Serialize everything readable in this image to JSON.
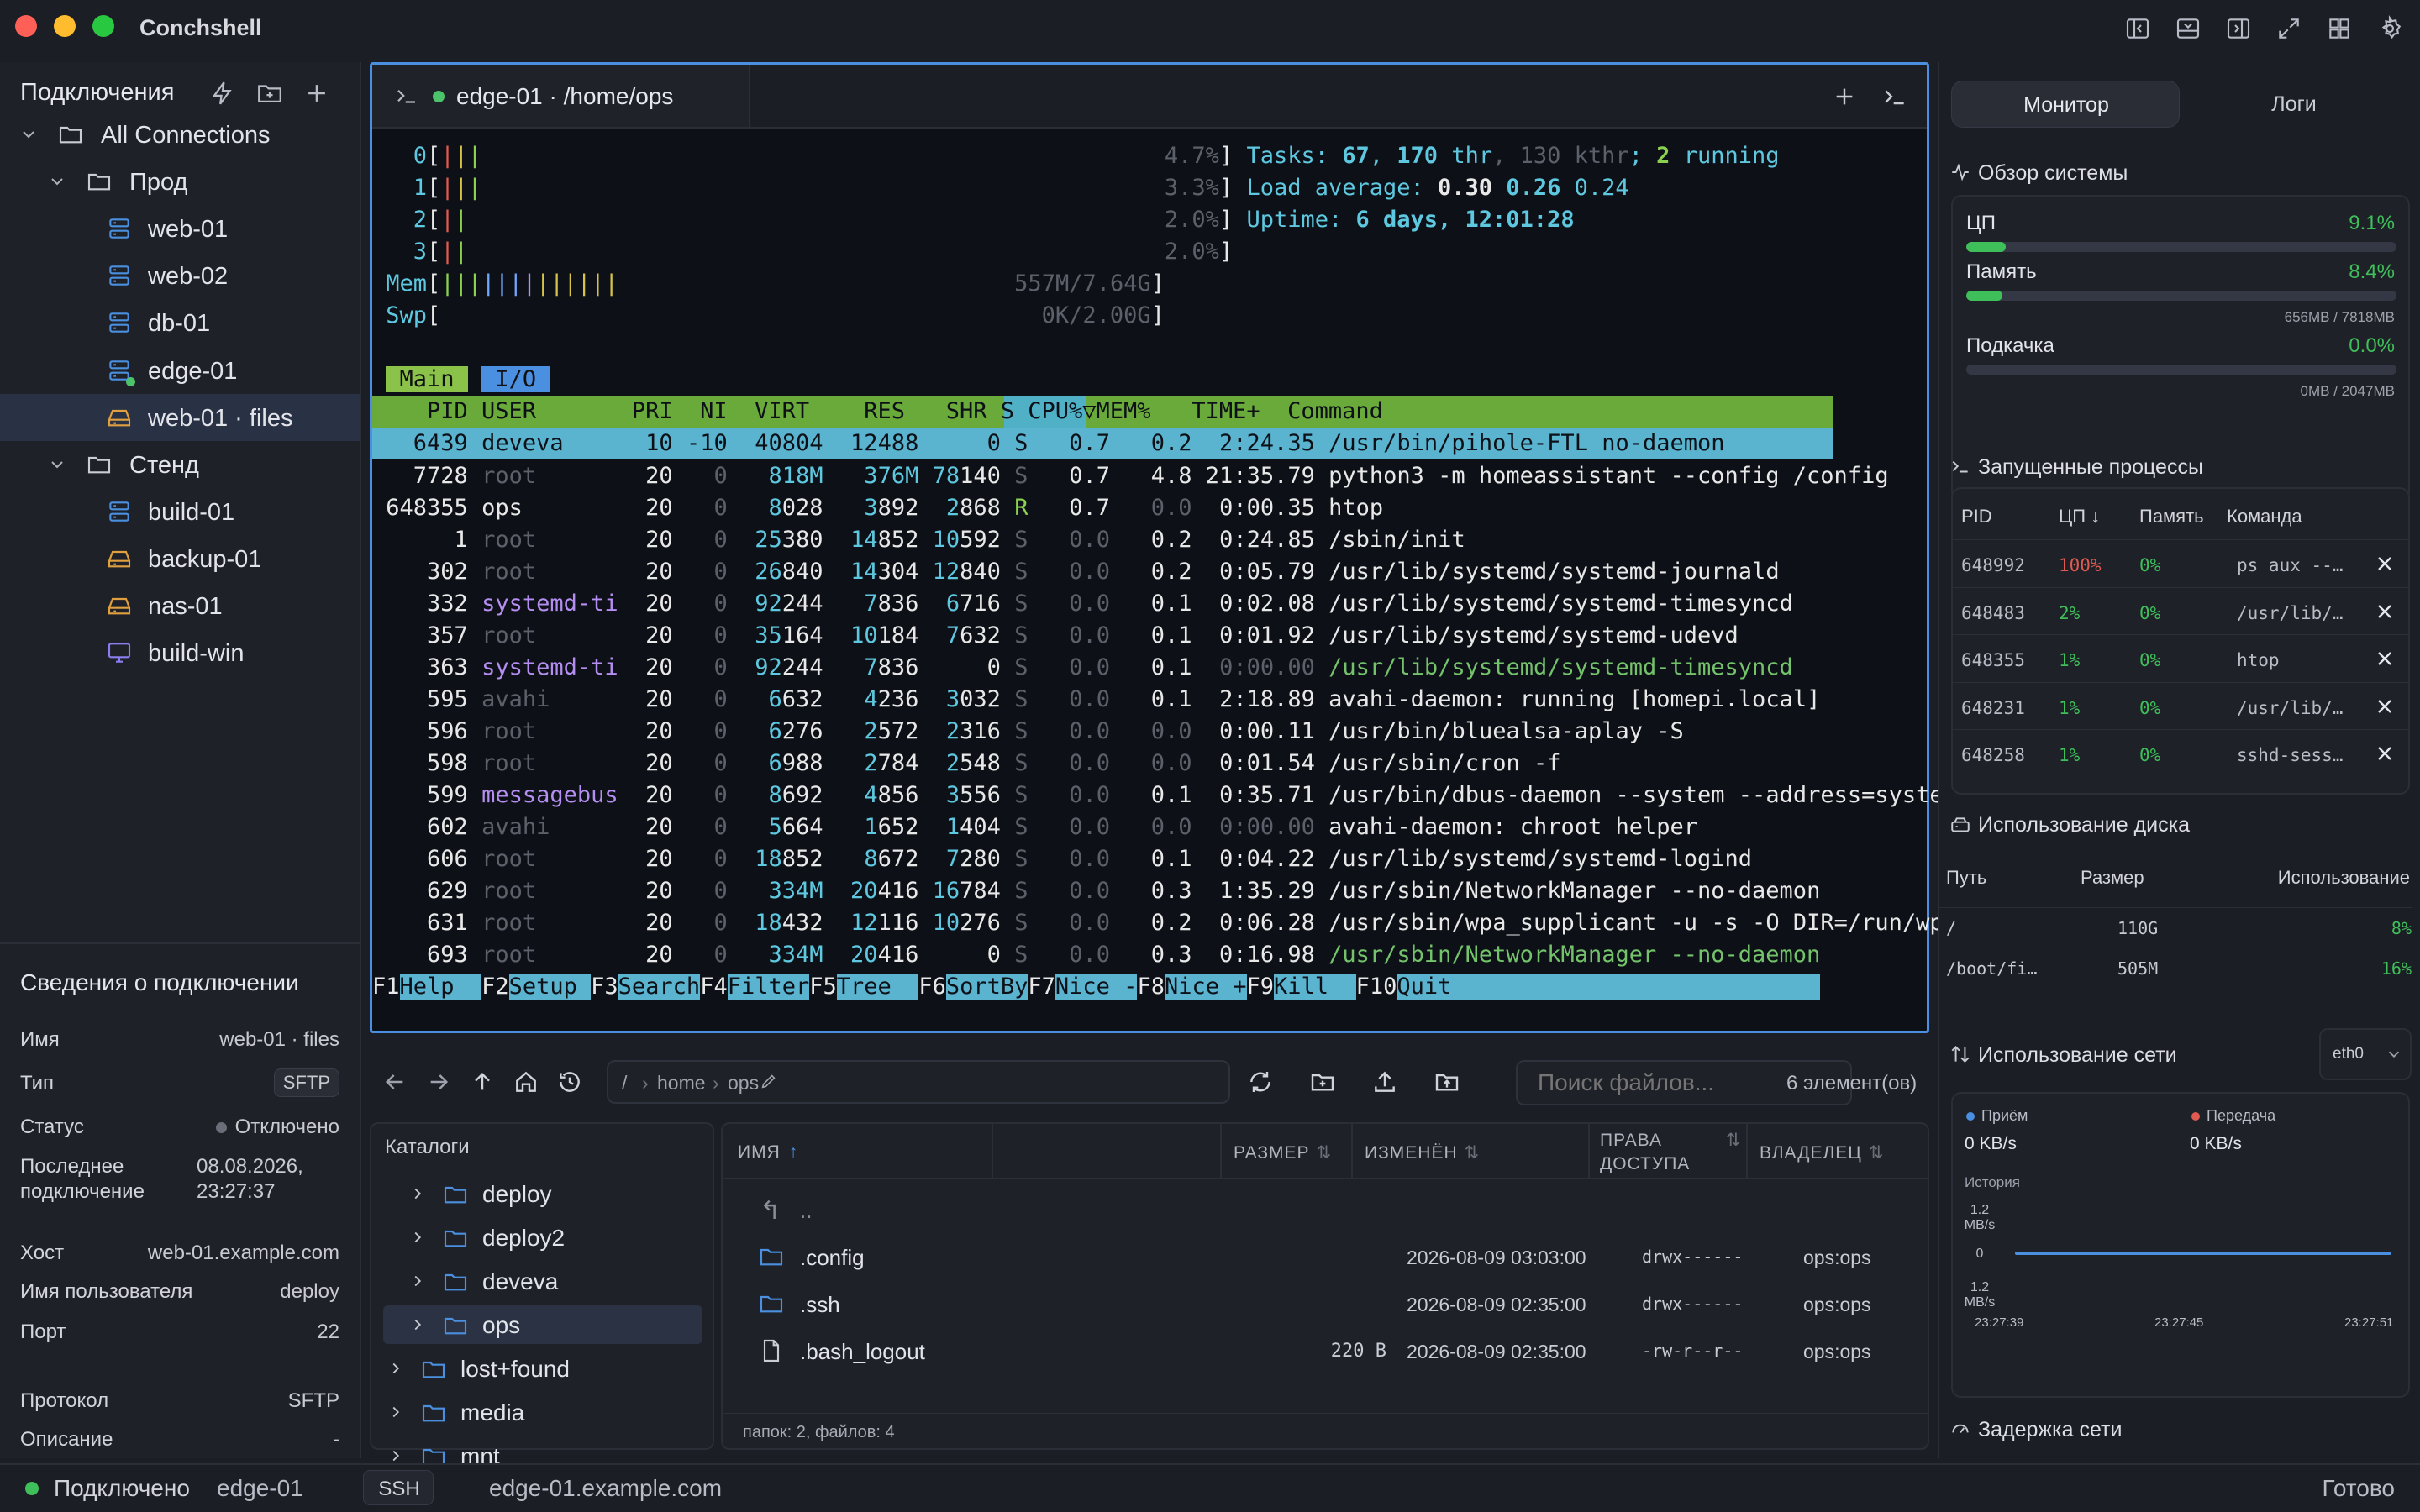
{
  "app": {
    "title": "Conchshell"
  },
  "sidebar": {
    "header": "Подключения",
    "tree": [
      {
        "label": "All Connections",
        "level": 0,
        "kind": "folder",
        "expanded": true
      },
      {
        "label": "Прод",
        "level": 1,
        "kind": "folder",
        "expanded": true
      },
      {
        "label": "web-01",
        "level": 2,
        "kind": "server"
      },
      {
        "label": "web-02",
        "level": 2,
        "kind": "server"
      },
      {
        "label": "db-01",
        "level": 2,
        "kind": "server"
      },
      {
        "label": "edge-01",
        "level": 2,
        "kind": "server",
        "connected": true
      },
      {
        "label": "web-01 · files",
        "level": 2,
        "kind": "files",
        "selected": true
      },
      {
        "label": "Стенд",
        "level": 1,
        "kind": "folder",
        "expanded": true
      },
      {
        "label": "build-01",
        "level": 2,
        "kind": "server"
      },
      {
        "label": "backup-01",
        "level": 2,
        "kind": "files"
      },
      {
        "label": "nas-01",
        "level": 2,
        "kind": "files"
      },
      {
        "label": "build-win",
        "level": 2,
        "kind": "desktop"
      }
    ],
    "info": {
      "title": "Сведения о подключении",
      "rows": [
        {
          "k": "Имя",
          "v": "web-01 · files"
        },
        {
          "k": "Тип",
          "v": "SFTP"
        },
        {
          "k": "Статус",
          "v": "Отключено"
        },
        {
          "k": "Последнее подключение",
          "v": "08.08.2026, 23:27:37"
        },
        {
          "k": "Хост",
          "v": "web-01.example.com"
        },
        {
          "k": "Имя пользователя",
          "v": "deploy"
        },
        {
          "k": "Порт",
          "v": "22"
        },
        {
          "k": "Протокол",
          "v": "SFTP"
        },
        {
          "k": "Описание",
          "v": "-"
        }
      ]
    }
  },
  "terminal": {
    "tab_title": "edge-01 · /home/ops",
    "cpus": [
      {
        "id": "0",
        "pct": "4.7%"
      },
      {
        "id": "1",
        "pct": "3.3%"
      },
      {
        "id": "2",
        "pct": "2.0%"
      },
      {
        "id": "3",
        "pct": "2.0%"
      }
    ],
    "mem": {
      "label": "Mem",
      "value": "557M/7.64G"
    },
    "swp": {
      "label": "Swp",
      "value": "0K/2.00G"
    },
    "tasks": {
      "label": "Tasks:",
      "tasks": "67",
      "thr": "170",
      "kthr": "130",
      "running": "2"
    },
    "load": {
      "label": "Load average:",
      "l1": "0.30",
      "l5": "0.26",
      "l15": "0.24"
    },
    "uptime": {
      "label": "Uptime:",
      "value": "6 days, 12:01:28"
    },
    "tabs": [
      "Main",
      "I/O"
    ],
    "columns": {
      "pid": "PID",
      "user": "USER",
      "pri": "PRI",
      "ni": "NI",
      "virt": "VIRT",
      "res": "RES",
      "shr": "SHR",
      "s": "S",
      "cpu": "CPU%▽",
      "mem": "MEM%",
      "time": "TIME+",
      "cmd": "Command"
    },
    "processes": [
      {
        "pid": "6439",
        "user": "deveva",
        "pri": "10",
        "ni": "-10",
        "virt": "40804",
        "res": "12488",
        "shr": "0",
        "s": "S",
        "cpu": "0.7",
        "mem": "0.2",
        "time": "2:24.35",
        "cmd": "/usr/bin/pihole-FTL no-daemon",
        "sel": true
      },
      {
        "pid": "7728",
        "user": "root",
        "pri": "20",
        "ni": "0",
        "virt": "818M",
        "res": "376M",
        "shr": "78140",
        "s": "S",
        "cpu": "0.7",
        "mem": "4.8",
        "time": "21:35.79",
        "cmd": "python3 -m homeassistant --config /config"
      },
      {
        "pid": "648355",
        "user": "ops",
        "pri": "20",
        "ni": "0",
        "virt": "8028",
        "res": "3892",
        "shr": "2868",
        "s": "R",
        "cpu": "0.7",
        "mem": "0.0",
        "time": "0:00.35",
        "cmd": "htop"
      },
      {
        "pid": "1",
        "user": "root",
        "pri": "20",
        "ni": "0",
        "virt": "25380",
        "res": "14852",
        "shr": "10592",
        "s": "S",
        "cpu": "0.0",
        "mem": "0.2",
        "time": "0:24.85",
        "cmd": "/sbin/init"
      },
      {
        "pid": "302",
        "user": "root",
        "pri": "20",
        "ni": "0",
        "virt": "26840",
        "res": "14304",
        "shr": "12840",
        "s": "S",
        "cpu": "0.0",
        "mem": "0.2",
        "time": "0:05.79",
        "cmd": "/usr/lib/systemd/systemd-journald"
      },
      {
        "pid": "332",
        "user": "systemd-ti",
        "pri": "20",
        "ni": "0",
        "virt": "92244",
        "res": "7836",
        "shr": "6716",
        "s": "S",
        "cpu": "0.0",
        "mem": "0.1",
        "time": "0:02.08",
        "cmd": "/usr/lib/systemd/systemd-timesyncd"
      },
      {
        "pid": "357",
        "user": "root",
        "pri": "20",
        "ni": "0",
        "virt": "35164",
        "res": "10184",
        "shr": "7632",
        "s": "S",
        "cpu": "0.0",
        "mem": "0.1",
        "time": "0:01.92",
        "cmd": "/usr/lib/systemd/systemd-udevd"
      },
      {
        "pid": "363",
        "user": "systemd-ti",
        "pri": "20",
        "ni": "0",
        "virt": "92244",
        "res": "7836",
        "shr": "0",
        "s": "S",
        "cpu": "0.0",
        "mem": "0.1",
        "time": "0:00.00",
        "cmd": "/usr/lib/systemd/systemd-timesyncd",
        "thread": true
      },
      {
        "pid": "595",
        "user": "avahi",
        "pri": "20",
        "ni": "0",
        "virt": "6632",
        "res": "4236",
        "shr": "3032",
        "s": "S",
        "cpu": "0.0",
        "mem": "0.1",
        "time": "2:18.89",
        "cmd": "avahi-daemon: running [homepi.local]"
      },
      {
        "pid": "596",
        "user": "root",
        "pri": "20",
        "ni": "0",
        "virt": "6276",
        "res": "2572",
        "shr": "2316",
        "s": "S",
        "cpu": "0.0",
        "mem": "0.0",
        "time": "0:00.11",
        "cmd": "/usr/bin/bluealsa-aplay -S"
      },
      {
        "pid": "598",
        "user": "root",
        "pri": "20",
        "ni": "0",
        "virt": "6988",
        "res": "2784",
        "shr": "2548",
        "s": "S",
        "cpu": "0.0",
        "mem": "0.0",
        "time": "0:01.54",
        "cmd": "/usr/sbin/cron -f"
      },
      {
        "pid": "599",
        "user": "messagebus",
        "pri": "20",
        "ni": "0",
        "virt": "8692",
        "res": "4856",
        "shr": "3556",
        "s": "S",
        "cpu": "0.0",
        "mem": "0.1",
        "time": "0:35.71",
        "cmd": "/usr/bin/dbus-daemon --system --address=system"
      },
      {
        "pid": "602",
        "user": "avahi",
        "pri": "20",
        "ni": "0",
        "virt": "5664",
        "res": "1652",
        "shr": "1404",
        "s": "S",
        "cpu": "0.0",
        "mem": "0.0",
        "time": "0:00.00",
        "cmd": "avahi-daemon: chroot helper"
      },
      {
        "pid": "606",
        "user": "root",
        "pri": "20",
        "ni": "0",
        "virt": "18852",
        "res": "8672",
        "shr": "7280",
        "s": "S",
        "cpu": "0.0",
        "mem": "0.1",
        "time": "0:04.22",
        "cmd": "/usr/lib/systemd/systemd-logind"
      },
      {
        "pid": "629",
        "user": "root",
        "pri": "20",
        "ni": "0",
        "virt": "334M",
        "res": "20416",
        "shr": "16784",
        "s": "S",
        "cpu": "0.0",
        "mem": "0.3",
        "time": "1:35.29",
        "cmd": "/usr/sbin/NetworkManager --no-daemon"
      },
      {
        "pid": "631",
        "user": "root",
        "pri": "20",
        "ni": "0",
        "virt": "18432",
        "res": "12116",
        "shr": "10276",
        "s": "S",
        "cpu": "0.0",
        "mem": "0.2",
        "time": "0:06.28",
        "cmd": "/usr/sbin/wpa_supplicant -u -s -O DIR=/run/wpa"
      },
      {
        "pid": "693",
        "user": "root",
        "pri": "20",
        "ni": "0",
        "virt": "334M",
        "res": "20416",
        "shr": "0",
        "s": "S",
        "cpu": "0.0",
        "mem": "0.3",
        "time": "0:16.98",
        "cmd": "/usr/sbin/NetworkManager --no-daemon",
        "thread": true
      }
    ],
    "fkeys": [
      {
        "k": "F1",
        "l": "Help  "
      },
      {
        "k": "F2",
        "l": "Setup "
      },
      {
        "k": "F3",
        "l": "Search"
      },
      {
        "k": "F4",
        "l": "Filter"
      },
      {
        "k": "F5",
        "l": "Tree  "
      },
      {
        "k": "F6",
        "l": "SortBy"
      },
      {
        "k": "F7",
        "l": "Nice -"
      },
      {
        "k": "F8",
        "l": "Nice +"
      },
      {
        "k": "F9",
        "l": "Kill  "
      },
      {
        "k": "F10",
        "l": "Quit"
      }
    ]
  },
  "files": {
    "path": [
      "/",
      "home",
      "ops"
    ],
    "search_placeholder": "Поиск файлов...",
    "count": "6 элемент(ов)",
    "catalogs_title": "Каталоги",
    "catalogs": [
      {
        "label": "deploy",
        "level": 1
      },
      {
        "label": "deploy2",
        "level": 1
      },
      {
        "label": "deveva",
        "level": 1
      },
      {
        "label": "ops",
        "level": 1,
        "selected": true
      },
      {
        "label": "lost+found",
        "level": 0
      },
      {
        "label": "media",
        "level": 0
      },
      {
        "label": "mnt",
        "level": 0
      }
    ],
    "headers": {
      "name": "ИМЯ",
      "size": "РАЗМЕР",
      "modified": "ИЗМЕНЁН",
      "perms": "ПРАВА ДОСТУПА",
      "owner": "ВЛАДЕЛЕЦ"
    },
    "parent": "..",
    "rows": [
      {
        "name": ".config",
        "size": "",
        "modified": "2026-08-09 03:03:00",
        "perms": "drwx------",
        "owner": "ops:ops",
        "kind": "dir"
      },
      {
        "name": ".ssh",
        "size": "",
        "modified": "2026-08-09 02:35:00",
        "perms": "drwx------",
        "owner": "ops:ops",
        "kind": "dir"
      },
      {
        "name": ".bash_logout",
        "size": "220 B",
        "modified": "2026-08-09 02:35:00",
        "perms": "-rw-r--r--",
        "owner": "ops:ops",
        "kind": "file"
      }
    ],
    "footer": "папок: 2, файлов: 4"
  },
  "monitor": {
    "tabs": [
      "Монитор",
      "Логи"
    ],
    "overview_title": "Обзор системы",
    "cpu": {
      "label": "ЦП",
      "value": "9.1%",
      "fraction": 0.091
    },
    "memory": {
      "label": "Память",
      "value": "8.4%",
      "fraction": 0.084,
      "detail": "656MB / 7818MB"
    },
    "swap": {
      "label": "Подкачка",
      "value": "0.0%",
      "fraction": 0.0,
      "detail": "0MB / 2047MB"
    },
    "proc_title": "Запущенные процессы",
    "proc_headers": {
      "pid": "PID",
      "cpu": "ЦП",
      "mem": "Память",
      "cmd": "Команда"
    },
    "procs": [
      {
        "pid": "648992",
        "cpu": "100%",
        "mem": "0%",
        "cmd": "ps aux --…",
        "hot": true
      },
      {
        "pid": "648483",
        "cpu": "2%",
        "mem": "0%",
        "cmd": "/usr/lib/…"
      },
      {
        "pid": "648355",
        "cpu": "1%",
        "mem": "0%",
        "cmd": "htop"
      },
      {
        "pid": "648231",
        "cpu": "1%",
        "mem": "0%",
        "cmd": "/usr/lib/…"
      },
      {
        "pid": "648258",
        "cpu": "1%",
        "mem": "0%",
        "cmd": "sshd-sess…"
      }
    ],
    "disk_title": "Использование диска",
    "disk_headers": {
      "path": "Путь",
      "size": "Размер",
      "usage": "Использование"
    },
    "disks": [
      {
        "path": "/",
        "size": "110G",
        "usage": "8%"
      },
      {
        "path": "/boot/fi…",
        "size": "505M",
        "usage": "16%"
      }
    ],
    "net_title": "Использование сети",
    "iface": "eth0",
    "rx_label": "Приём",
    "rx_value": "0 KB/s",
    "tx_label": "Передача",
    "tx_value": "0 KB/s",
    "history_label": "История",
    "y_top": "1.2 MB/s",
    "y_mid": "0",
    "y_bot": "1.2 MB/s",
    "times": [
      "23:27:39",
      "23:27:45",
      "23:27:51"
    ],
    "latency_title": "Задержка сети",
    "colors": {
      "rx": "#4a8fe0",
      "tx": "#e05a4f",
      "ok": "#3fbf5a"
    }
  },
  "statusbar": {
    "state": "Подключено",
    "host_name": "edge-01",
    "proto": "SSH",
    "host": "edge-01.example.com",
    "ready": "Готово"
  }
}
